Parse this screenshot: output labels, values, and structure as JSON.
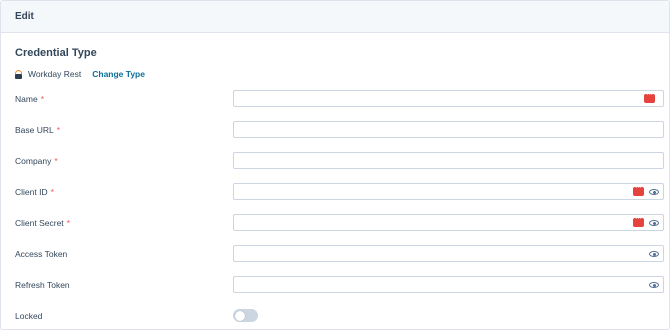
{
  "header": {
    "title": "Edit"
  },
  "section": {
    "title": "Credential Type"
  },
  "credential": {
    "name": "Workday Rest",
    "change_label": "Change Type",
    "icon": "workday-icon"
  },
  "fields": {
    "name": {
      "label": "Name",
      "required": "*",
      "value": "",
      "has_password_badge": true,
      "has_eye": false
    },
    "base_url": {
      "label": "Base URL",
      "required": "*",
      "value": ""
    },
    "company": {
      "label": "Company",
      "required": "*",
      "value": ""
    },
    "client_id": {
      "label": "Client ID",
      "required": "*",
      "value": "",
      "has_password_badge": true,
      "has_eye": true
    },
    "client_secret": {
      "label": "Client Secret",
      "required": "*",
      "value": "",
      "has_password_badge": true,
      "has_eye": true
    },
    "access_token": {
      "label": "Access Token",
      "value": "",
      "has_eye": true
    },
    "refresh_token": {
      "label": "Refresh Token",
      "value": "",
      "has_eye": true
    },
    "locked": {
      "label": "Locked",
      "value": false
    }
  },
  "colors": {
    "accent_link": "#0b6e99",
    "required": "#f2545b",
    "password_badge": "#e4433e",
    "toggle_off": "#cbd6e2"
  }
}
